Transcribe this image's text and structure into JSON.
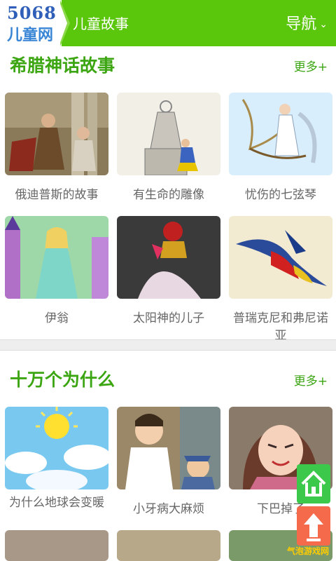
{
  "header": {
    "logo_number": "5068",
    "logo_text": "儿童网",
    "site_title": "儿童故事",
    "nav_label": "导航"
  },
  "section1": {
    "title": "希腊神话故事",
    "more": "更多+",
    "items": [
      {
        "caption": "俄迪普斯的故事",
        "image": "classical-painting"
      },
      {
        "caption": "有生命的雕像",
        "image": "statue-sketch"
      },
      {
        "caption": "忧伤的七弦琴",
        "image": "harp-angel"
      },
      {
        "caption": "伊翁",
        "image": "princess-castle"
      },
      {
        "caption": "太阳神的儿子",
        "image": "armored-warrior"
      },
      {
        "caption": "普瑞克尼和弗尼诺亚",
        "image": "swallow-bird"
      }
    ]
  },
  "section2": {
    "title": "十万个为什么",
    "more": "更多+",
    "items": [
      {
        "caption": "为什么地球会变暖",
        "image": "sun-clouds"
      },
      {
        "caption": "小牙病大麻烦",
        "image": "boy-doctor"
      },
      {
        "caption": "下巴掉了",
        "image": "woman-cartoon"
      }
    ]
  },
  "floating": {
    "home_icon": "home-icon",
    "top_icon": "arrow-up-icon"
  },
  "watermark": "气泡游戏网"
}
